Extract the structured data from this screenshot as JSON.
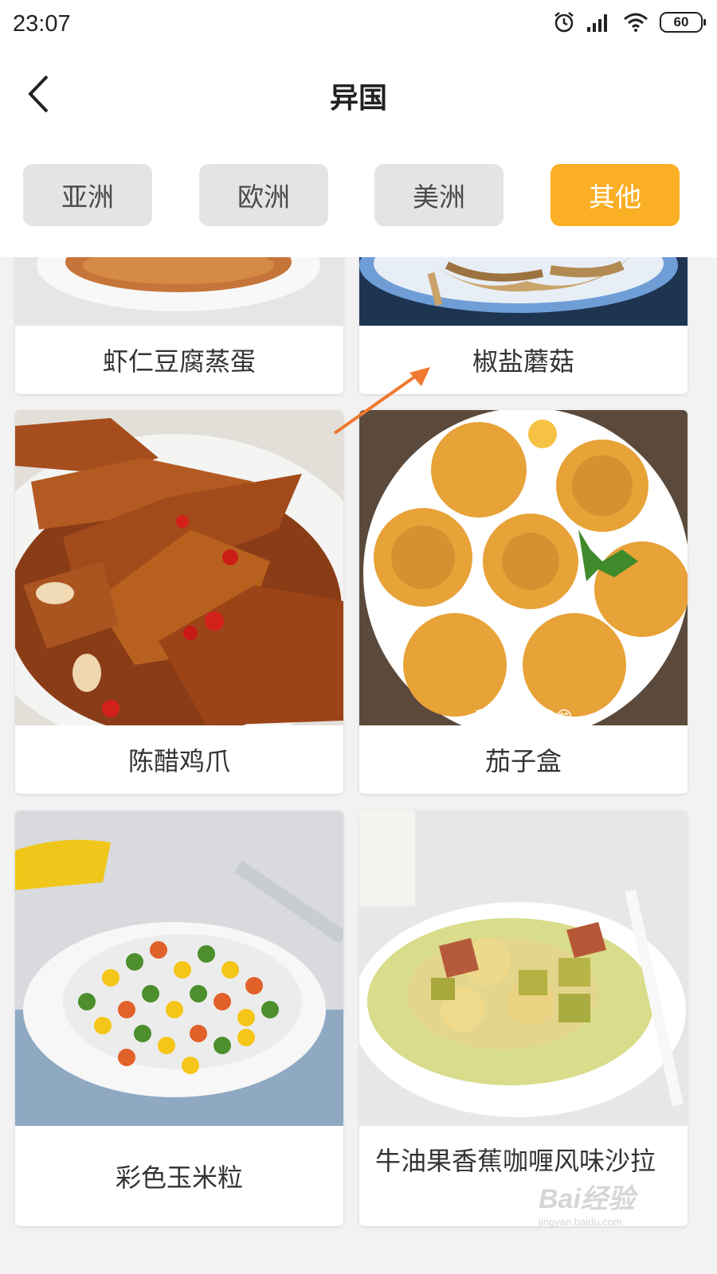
{
  "status_bar": {
    "time": "23:07",
    "battery": "60"
  },
  "header": {
    "title": "异国"
  },
  "tabs": [
    {
      "label": "亚洲",
      "active": false
    },
    {
      "label": "欧洲",
      "active": false
    },
    {
      "label": "美洲",
      "active": false
    },
    {
      "label": "其他",
      "active": true
    }
  ],
  "recipes": [
    {
      "name": "虾仁豆腐蒸蛋"
    },
    {
      "name": "椒盐蘑菇"
    },
    {
      "name": "陈醋鸡爪"
    },
    {
      "name": "茄子盒"
    },
    {
      "name": "彩色玉米粒"
    },
    {
      "name": "牛油果香蕉咖喱风味沙拉"
    }
  ],
  "photo_caption": "茄子盒😋😋😋",
  "watermark": {
    "brand": "Bai经验",
    "url": "jingyan.baidu.com"
  },
  "colors": {
    "accent": "#fbaf25",
    "tab_inactive": "#e4e4e4",
    "annotation_arrow": "#f07830"
  }
}
